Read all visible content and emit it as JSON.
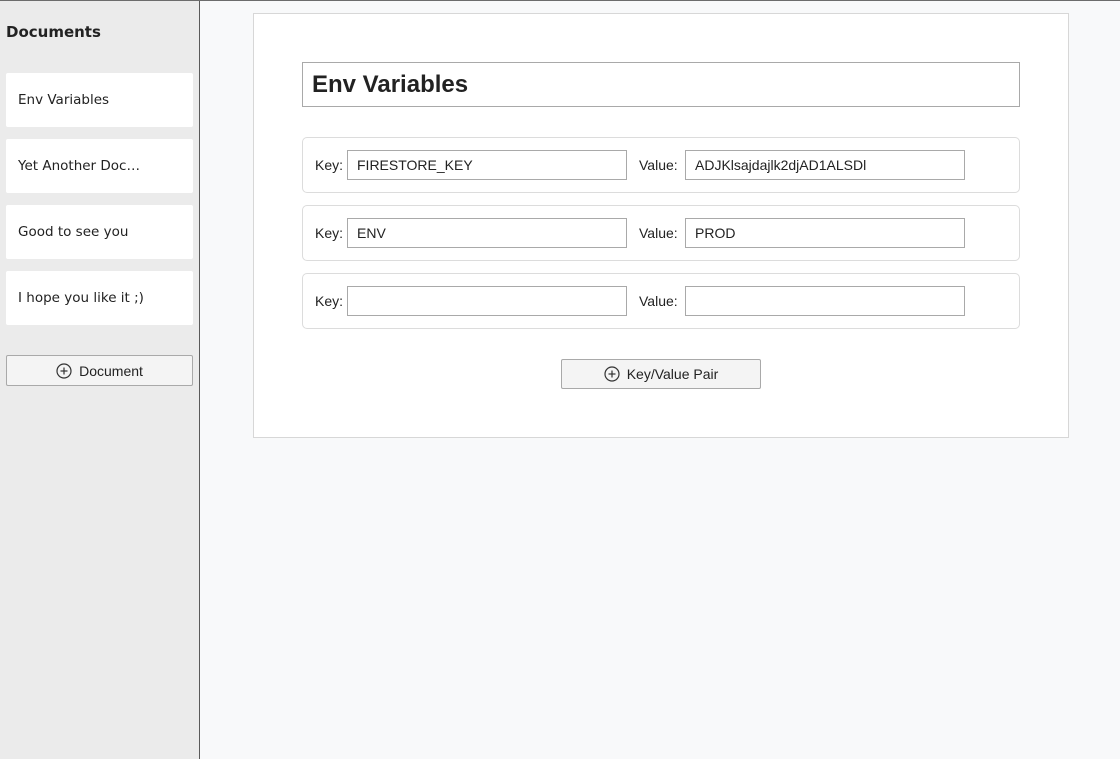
{
  "sidebar": {
    "title": "Documents",
    "documents": [
      {
        "label": "Env Variables"
      },
      {
        "label": "Yet Another Document"
      },
      {
        "label": "Good to see you"
      },
      {
        "label": "I hope you like it ;)"
      }
    ],
    "add_document_label": "Document",
    "add_icon": "circle-plus-icon"
  },
  "editor": {
    "title_value": "Env Variables",
    "key_label": "Key:",
    "value_label": "Value:",
    "pairs": [
      {
        "key": "FIRESTORE_KEY",
        "value": "ADJKlsajdajlk2djAD1ALSDl"
      },
      {
        "key": "ENV",
        "value": "PROD"
      },
      {
        "key": "",
        "value": ""
      }
    ],
    "add_pair_label": "Key/Value Pair",
    "add_icon": "circle-plus-icon"
  },
  "colors": {
    "sidebar_bg": "#ebebeb",
    "main_bg": "#f8f9fa",
    "card_bg": "#ffffff",
    "button_bg": "#f4f4f4"
  }
}
